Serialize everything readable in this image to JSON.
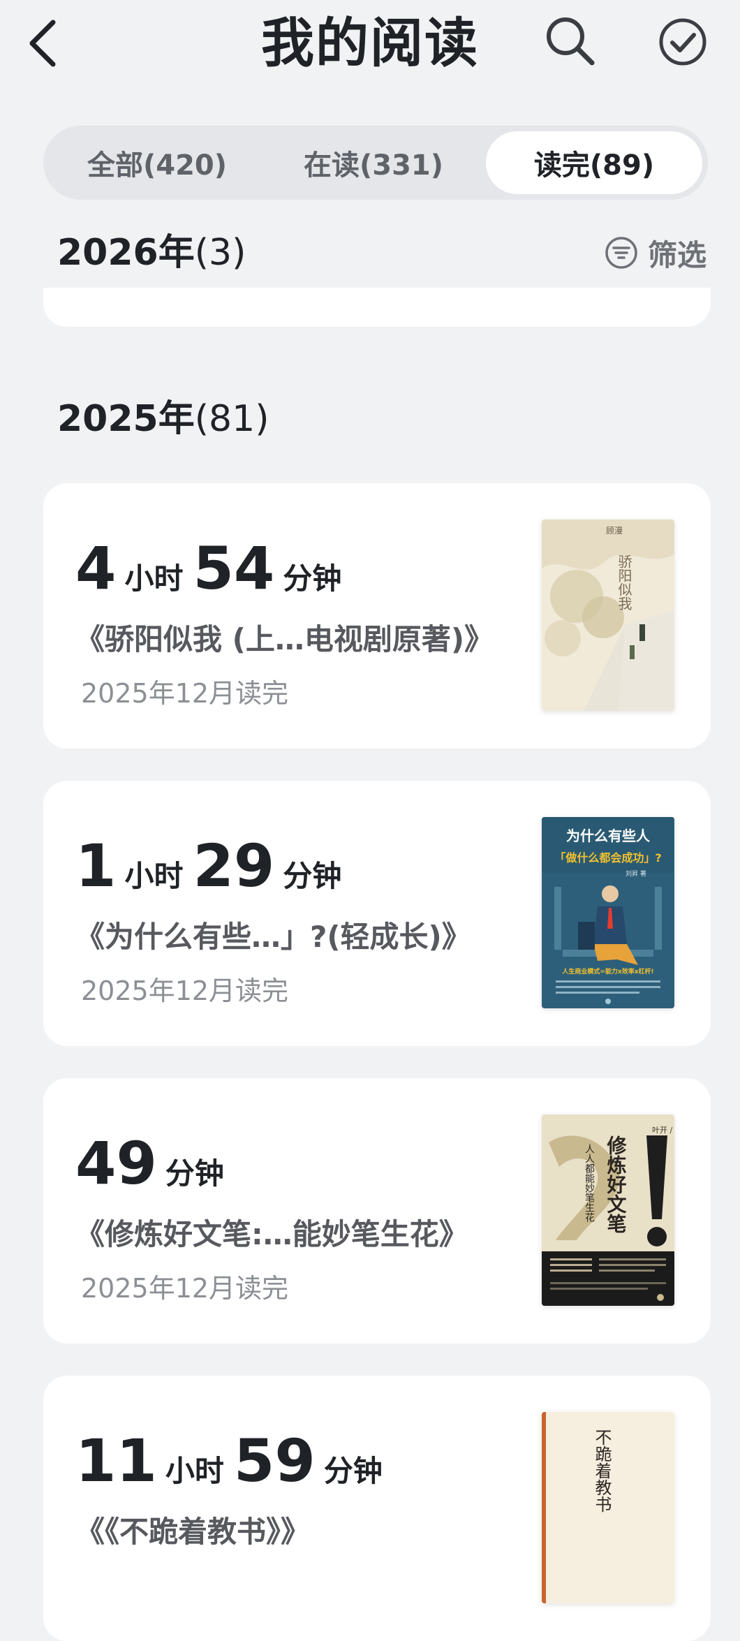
{
  "header": {
    "title": "我的阅读"
  },
  "tabs": [
    {
      "label": "全部(420)",
      "selected": false
    },
    {
      "label": "在读(331)",
      "selected": false
    },
    {
      "label": "读完(89)",
      "selected": true
    }
  ],
  "sections": [
    {
      "year": "2026年",
      "count": "(3)"
    },
    {
      "year": "2025年",
      "count": "(81)"
    }
  ],
  "filter": {
    "label": "筛选",
    "icon": "filter-icon"
  },
  "books": [
    {
      "duration": [
        "4",
        "小时",
        "54",
        "分钟"
      ],
      "title": "《骄阳似我 (上…电视剧原著)》",
      "finished": "2025年12月读完",
      "cover_color": "#efe6d6"
    },
    {
      "duration": [
        "1",
        "小时",
        "29",
        "分钟"
      ],
      "title": "《为什么有些…」?(轻成长)》",
      "finished": "2025年12月读完",
      "cover_color": "#2d5f7a"
    },
    {
      "duration": [
        "49",
        "分钟"
      ],
      "title": "《修炼好文笔:…能妙笔生花》",
      "finished": "2025年12月读完",
      "cover_color": "#e9e0c8"
    },
    {
      "duration": [
        "11",
        "小时",
        "59",
        "分钟"
      ],
      "title": "《《不跪着教书》》",
      "finished": "",
      "cover_color": "#f6efe0"
    }
  ],
  "covers": {
    "book1": {
      "author": "顾漫",
      "title": "骄阳似我"
    },
    "book2": {
      "title_line1": "为什么有些人",
      "title_line2": "「做什么都会成功」?",
      "author": "刘昇 著",
      "tagline": "人生商业模式=能力x效率x杠杆!"
    },
    "book3": {
      "author": "叶开 / 著",
      "title": "修炼好文笔",
      "subtitle": "人人都能妙笔生花"
    },
    "book4": {
      "title": "不跪着教书"
    }
  }
}
